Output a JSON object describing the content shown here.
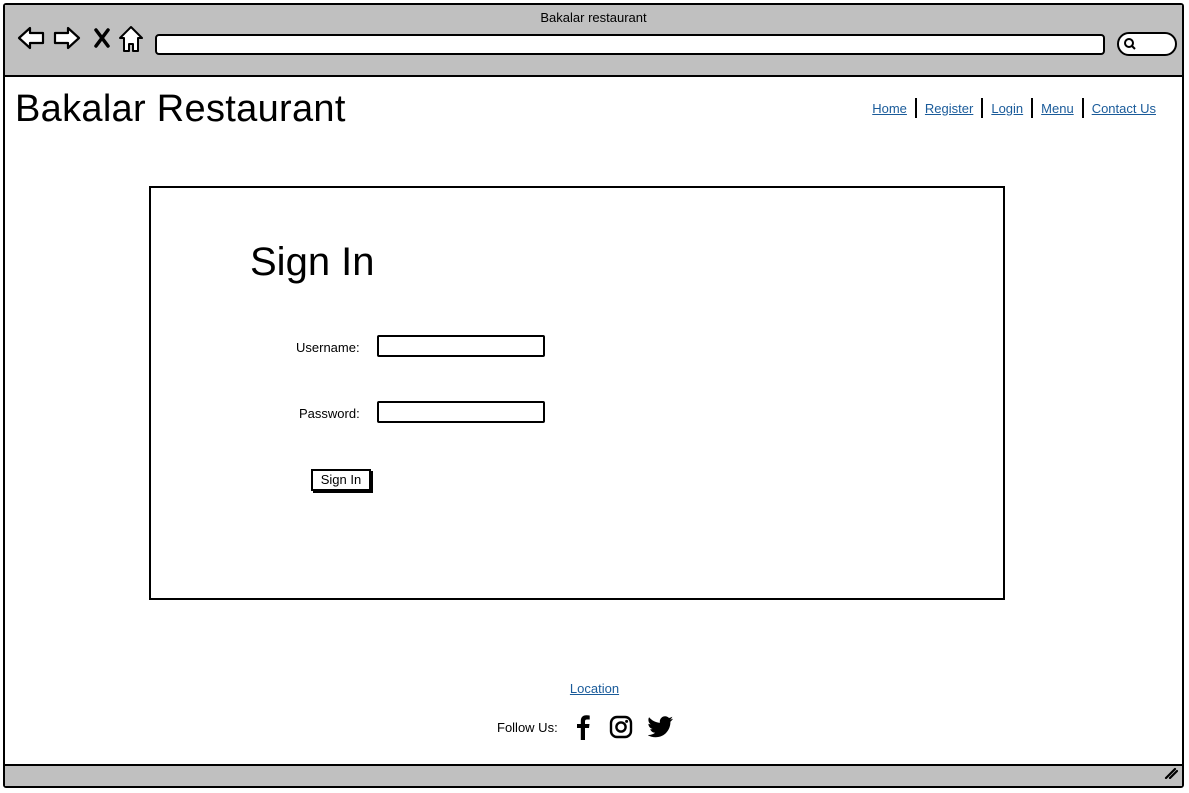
{
  "window": {
    "title": "Bakalar restaurant"
  },
  "site": {
    "brand": "Bakalar Restaurant"
  },
  "nav": {
    "items": [
      {
        "label": "Home"
      },
      {
        "label": "Register"
      },
      {
        "label": "Login"
      },
      {
        "label": "Menu"
      },
      {
        "label": "Contact Us"
      }
    ]
  },
  "signin": {
    "heading": "Sign In",
    "username_label": "Username:",
    "username_value": "",
    "password_label": "Password:",
    "password_value": "",
    "button_label": "Sign In"
  },
  "footer": {
    "location_link": "Location",
    "follow_label": "Follow Us:",
    "social_icons": [
      "facebook-icon",
      "instagram-icon",
      "twitter-icon"
    ]
  },
  "colors": {
    "link": "#1a5b9a",
    "chrome": "#c0c0c0",
    "border": "#000000"
  }
}
